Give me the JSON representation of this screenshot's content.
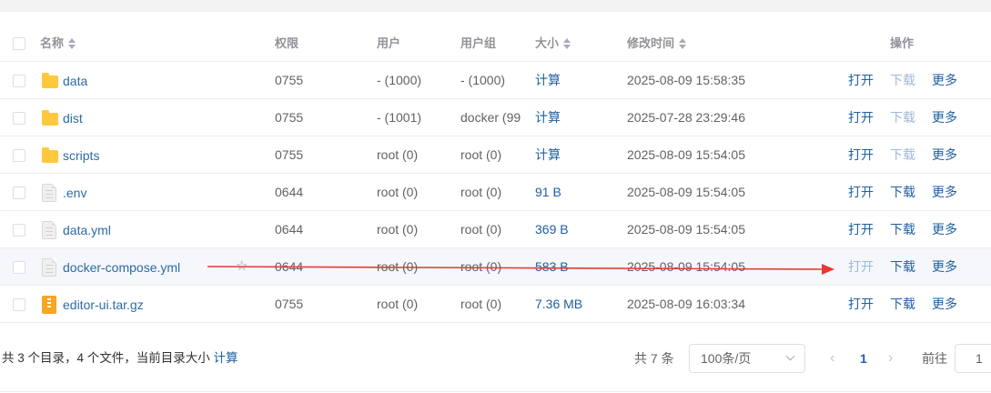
{
  "table": {
    "headers": {
      "name": "名称",
      "permission": "权限",
      "user": "用户",
      "group": "用户组",
      "size": "大小",
      "mtime": "修改时间",
      "actions": "操作"
    },
    "rows": [
      {
        "type": "folder",
        "name": "data",
        "permission": "0755",
        "user": "- (1000)",
        "group": "- (1000)",
        "size": "计算",
        "mtime": "2025-08-09 15:58:35",
        "open": "打开",
        "download": "下载",
        "more": "更多"
      },
      {
        "type": "folder",
        "name": "dist",
        "permission": "0755",
        "user": "- (1001)",
        "group": "docker (99",
        "size": "计算",
        "mtime": "2025-07-28 23:29:46",
        "open": "打开",
        "download": "下载",
        "more": "更多"
      },
      {
        "type": "folder",
        "name": "scripts",
        "permission": "0755",
        "user": "root (0)",
        "group": "root (0)",
        "size": "计算",
        "mtime": "2025-08-09 15:54:05",
        "open": "打开",
        "download": "下载",
        "more": "更多"
      },
      {
        "type": "file",
        "name": ".env",
        "permission": "0644",
        "user": "root (0)",
        "group": "root (0)",
        "size": "91 B",
        "mtime": "2025-08-09 15:54:05",
        "open": "打开",
        "download": "下载",
        "more": "更多"
      },
      {
        "type": "file",
        "name": "data.yml",
        "permission": "0644",
        "user": "root (0)",
        "group": "root (0)",
        "size": "369 B",
        "mtime": "2025-08-09 15:54:05",
        "open": "打开",
        "download": "下载",
        "more": "更多"
      },
      {
        "type": "file",
        "name": "docker-compose.yml",
        "permission": "0644",
        "user": "root (0)",
        "group": "root (0)",
        "size": "583 B",
        "mtime": "2025-08-09 15:54:05",
        "open": "打开",
        "download": "下载",
        "more": "更多"
      },
      {
        "type": "archive",
        "name": "editor-ui.tar.gz",
        "permission": "0755",
        "user": "root (0)",
        "group": "root (0)",
        "size": "7.36 MB",
        "mtime": "2025-08-09 16:03:34",
        "open": "打开",
        "download": "下载",
        "more": "更多"
      }
    ]
  },
  "footer": {
    "summary": "共 3 个目录，4 个文件，当前目录大小",
    "summary_link": "计算",
    "total": "共 7 条",
    "page_size": "100条/页",
    "current_page": "1",
    "goto_label": "前往",
    "goto_value": "1"
  },
  "icons": {
    "folder": "folder-icon",
    "file": "file-icon",
    "archive": "archive-icon",
    "sort": "sort-icon",
    "star": "star-icon"
  },
  "colors": {
    "link": "#2060a0",
    "folder": "#ffc83d",
    "archive": "#f5a623",
    "annotation_arrow": "#e53935"
  }
}
